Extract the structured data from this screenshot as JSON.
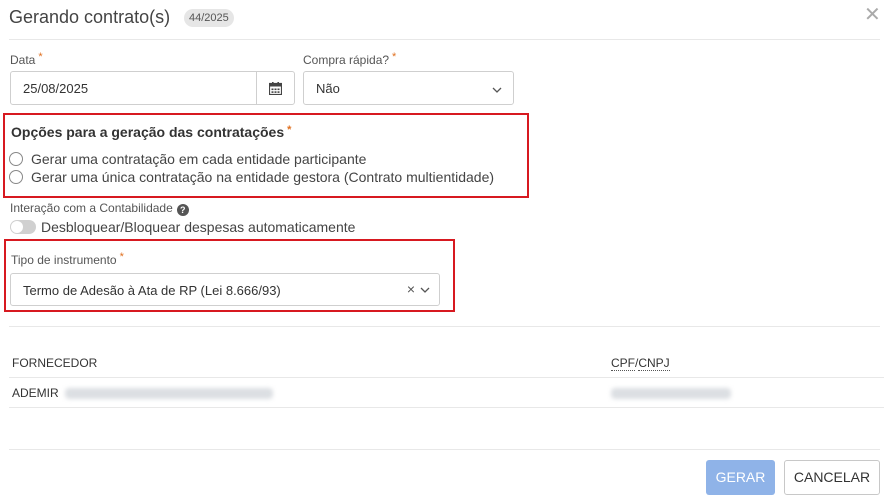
{
  "dialog": {
    "title": "Gerando contrato(s)",
    "badge": "44/2025"
  },
  "form": {
    "data": {
      "label": "Data",
      "required": "*",
      "value": "25/08/2025"
    },
    "compra_rapida": {
      "label": "Compra rápida?",
      "required": "*",
      "value": "Não"
    },
    "opcoes": {
      "title": "Opções para a geração das contratações",
      "required": "*",
      "options": [
        "Gerar uma contratação em cada entidade participante",
        "Gerar uma única contratação na entidade gestora (Contrato multientidade)"
      ]
    },
    "contabilidade": {
      "label": "Interação com a Contabilidade",
      "toggle_label": "Desbloquear/Bloquear despesas automaticamente"
    },
    "instrumento": {
      "label": "Tipo de instrumento",
      "required": "*",
      "value": "Termo de Adesão à Ata de RP (Lei 8.666/93)"
    }
  },
  "table": {
    "headers": {
      "fornecedor": "FORNECEDOR",
      "cpf": "CPF",
      "sep": "/",
      "cnpj": "CNPJ"
    },
    "rows": [
      {
        "fornecedor": "ADEMIR"
      }
    ]
  },
  "footer": {
    "gerar": "GERAR",
    "cancelar": "CANCELAR"
  },
  "colors": {
    "accent_red": "#d71920",
    "required": "#e07020",
    "primary_disabled": "#8fb3e8"
  },
  "icons": [
    "close-icon",
    "calendar-icon",
    "chevron-down-icon",
    "clear-icon",
    "help-icon"
  ]
}
